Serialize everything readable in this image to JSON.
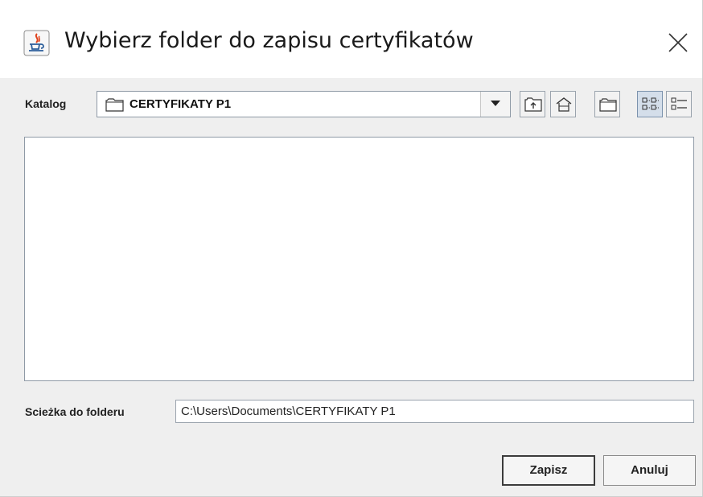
{
  "window": {
    "title": "Wybierz folder do zapisu certyfikatów",
    "app_icon": "java-icon",
    "close_icon": "close-icon"
  },
  "toolbar": {
    "katalog_label": "Katalog",
    "current_folder": "CERTYFIKATY P1",
    "folder_icon": "folder-icon",
    "dropdown_icon": "chevron-down-icon",
    "buttons": [
      {
        "icon": "up-folder-icon"
      },
      {
        "icon": "home-icon"
      },
      {
        "icon": "new-folder-icon"
      },
      {
        "icon": "list-view-icon",
        "pressed": true
      },
      {
        "icon": "details-view-icon",
        "pressed": false
      }
    ]
  },
  "file_list": {
    "items": []
  },
  "path": {
    "label": "Scieżka do folderu",
    "value": "C:\\Users\\Documents\\CERTYFIKATY P1"
  },
  "actions": {
    "save_label": "Zapisz",
    "cancel_label": "Anuluj"
  },
  "colors": {
    "accent_pressed": "#d4deea",
    "window_bg": "#efefef"
  }
}
